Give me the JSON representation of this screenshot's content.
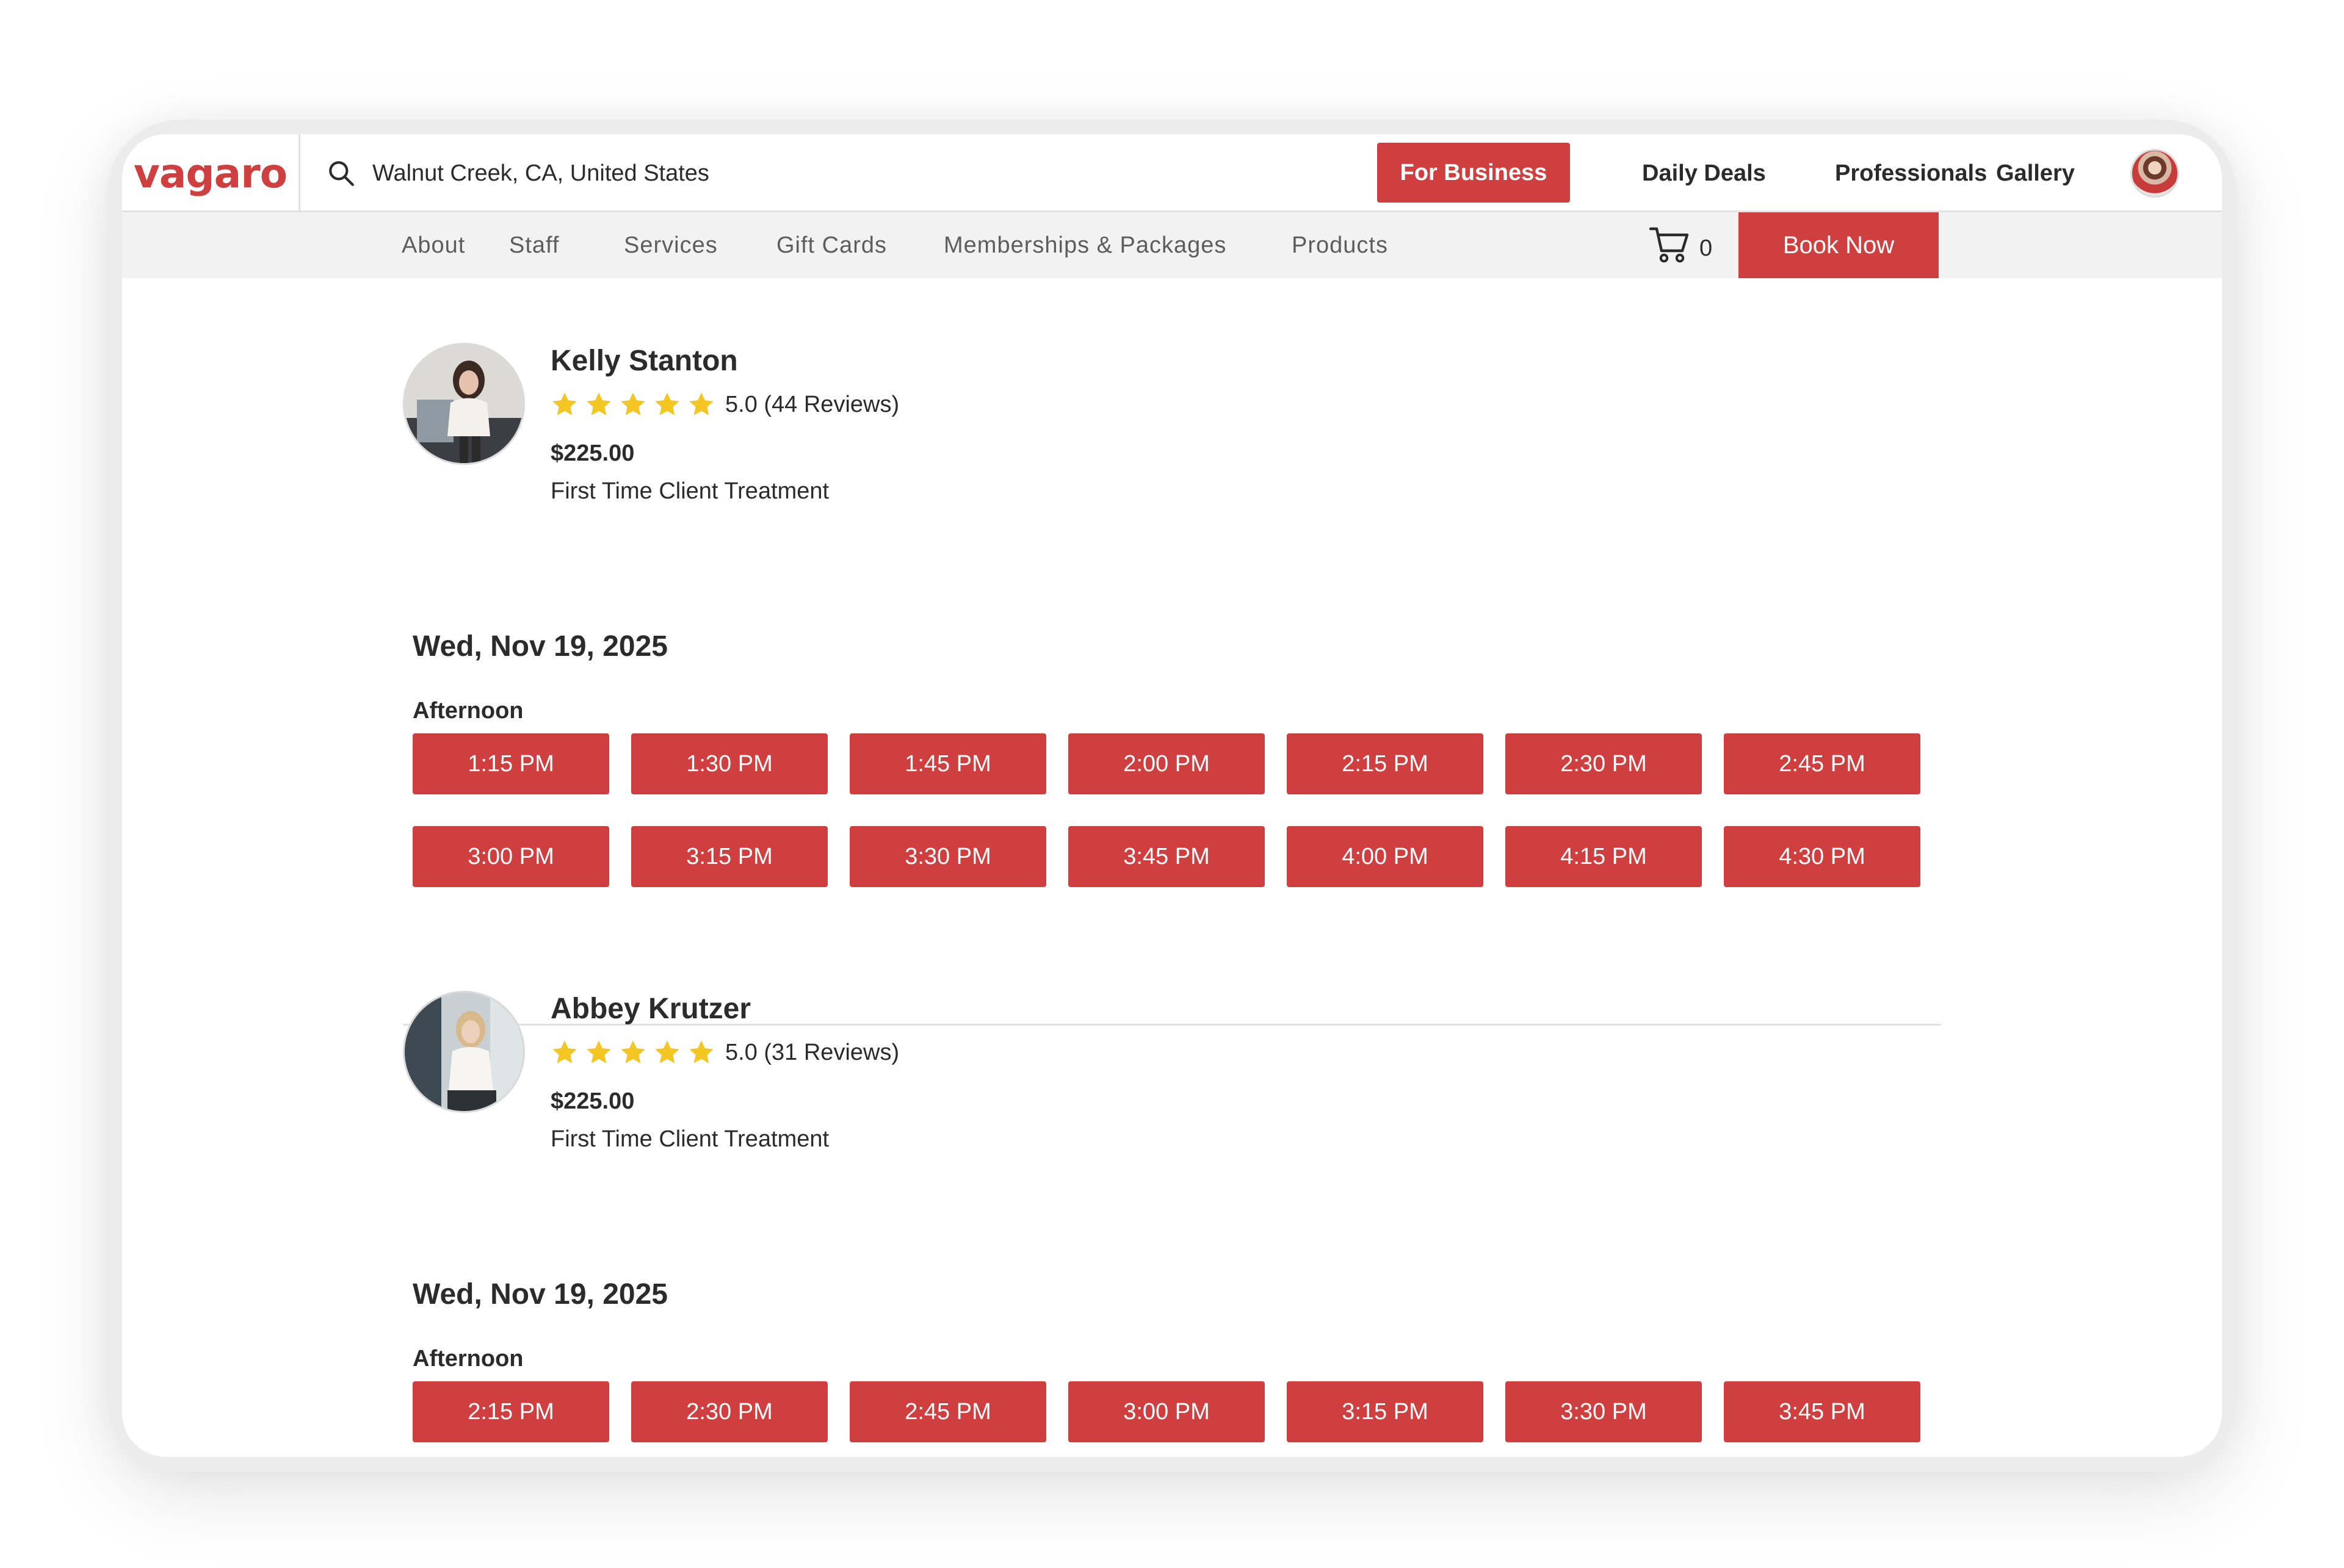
{
  "brand": {
    "logo": "vagaro",
    "accent": "#cf3f3f"
  },
  "search": {
    "location": "Walnut Creek, CA, United States"
  },
  "header": {
    "for_business": "For Business",
    "nav": [
      "Daily Deals",
      "Professionals",
      "Gallery"
    ]
  },
  "subnav": {
    "items": [
      "About",
      "Staff",
      "Services",
      "Gift Cards",
      "Memberships & Packages",
      "Products"
    ],
    "cart_count": "0",
    "book_now": "Book Now"
  },
  "providers": [
    {
      "name": "Kelly Stanton",
      "rating_text": "5.0 (44 Reviews)",
      "rating": 5,
      "price": "$225.00",
      "service": "First Time Client Treatment",
      "date": "Wed, Nov 19, 2025",
      "period": "Afternoon",
      "slots": [
        "1:15 PM",
        "1:30 PM",
        "1:45 PM",
        "2:00 PM",
        "2:15 PM",
        "2:30 PM",
        "2:45 PM",
        "3:00 PM",
        "3:15 PM",
        "3:30 PM",
        "3:45 PM",
        "4:00 PM",
        "4:15 PM",
        "4:30 PM"
      ]
    },
    {
      "name": "Abbey Krutzer",
      "rating_text": "5.0 (31 Reviews)",
      "rating": 5,
      "price": "$225.00",
      "service": "First Time Client Treatment",
      "date": "Wed, Nov 19, 2025",
      "period": "Afternoon",
      "slots": [
        "2:15 PM",
        "2:30 PM",
        "2:45 PM",
        "3:00 PM",
        "3:15 PM",
        "3:30 PM",
        "3:45 PM"
      ]
    }
  ]
}
